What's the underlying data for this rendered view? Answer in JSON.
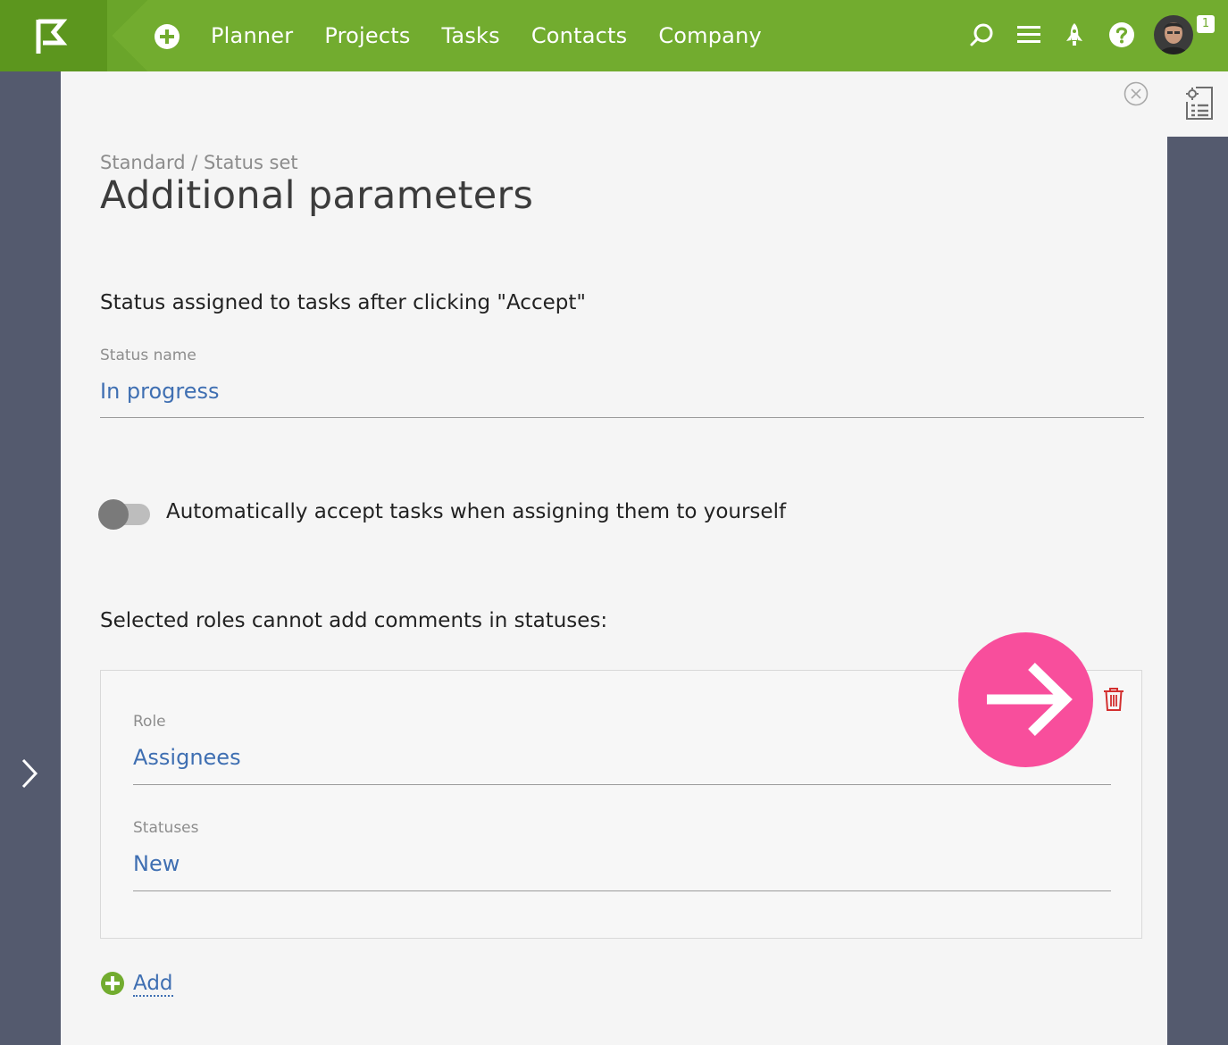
{
  "topbar": {
    "nav": [
      "Planner",
      "Projects",
      "Tasks",
      "Contacts",
      "Company"
    ],
    "notifications_count": "1",
    "brand_color": "#72ac2f"
  },
  "icons": {
    "logo": "flag-logo-icon",
    "add": "plus-circle-icon",
    "search": "search-icon",
    "menu": "hamburger-menu-icon",
    "rocket": "rocket-icon",
    "help": "question-icon",
    "close": "close-circle-icon",
    "settings": "settings-document-icon",
    "expand": "chevron-right-icon",
    "delete": "trash-icon",
    "hint": "arrow-right-icon"
  },
  "page": {
    "breadcrumb": "Standard / Status set",
    "title": "Additional parameters"
  },
  "accept_section": {
    "heading": "Status assigned to tasks after clicking \"Accept\"",
    "field_label": "Status name",
    "field_value": "In progress"
  },
  "auto_accept": {
    "label": "Automatically accept tasks when assigning them to yourself",
    "enabled": false
  },
  "comments_section": {
    "heading": "Selected roles cannot add comments in statuses:",
    "role_label": "Role",
    "role_value": "Assignees",
    "statuses_label": "Statuses",
    "statuses_value": "New",
    "add_label": "Add"
  },
  "colors": {
    "accent_link": "#3f6fb2",
    "hint_pink": "#f84e9c",
    "delete_red": "#d32f2f",
    "sidebar": "#545a6e"
  }
}
